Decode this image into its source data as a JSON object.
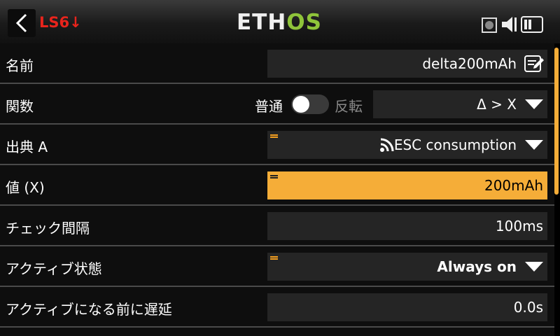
{
  "header": {
    "title": "LS6↓",
    "logo_part1": "ETH",
    "logo_part2": "OS"
  },
  "rows": [
    {
      "label": "名前",
      "value": "delta200mAh"
    },
    {
      "label": "関数",
      "toggle_left": "普通",
      "toggle_right": "反転",
      "value": "Δ > X"
    },
    {
      "label": "出典 A",
      "value": "ESC consumption"
    },
    {
      "label": "値 (X)",
      "value": "200mAh"
    },
    {
      "label": "チェック間隔",
      "value": "100ms"
    },
    {
      "label": "アクティブ状態",
      "value": "Always on"
    },
    {
      "label": "アクティブになる前に遅延",
      "value": "0.0s"
    }
  ],
  "colors": {
    "accent": "#f5ad38",
    "title_red": "#e8241c",
    "logo_green": "#8fc43a"
  },
  "icons": [
    "back-chevron-icon",
    "edit-icon",
    "telemetry-signal-icon",
    "sd-card-icon",
    "speaker-icon",
    "battery-icon"
  ]
}
